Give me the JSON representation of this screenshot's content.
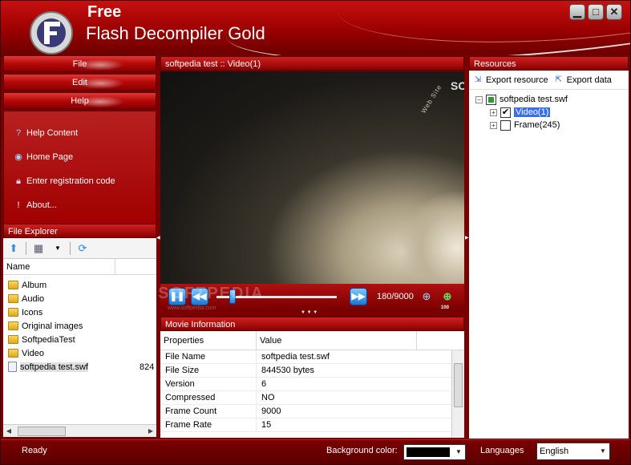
{
  "app": {
    "title_free": "Free",
    "title_main": "Flash Decompiler Gold",
    "window_buttons": {
      "minimize": "▁",
      "maximize": "□",
      "close": "✕"
    }
  },
  "left_menu": {
    "file": "File",
    "edit": "Edit",
    "help": "Help",
    "help_items": [
      {
        "label": "Help Content",
        "icon": "help-icon"
      },
      {
        "label": "Home Page",
        "icon": "globe-icon"
      },
      {
        "label": "Enter registration code",
        "icon": "lock-icon"
      },
      {
        "label": "About...",
        "icon": "info-icon"
      }
    ]
  },
  "file_explorer": {
    "title": "File Explorer",
    "column_name": "Name",
    "items": [
      {
        "name": "Album",
        "type": "folder"
      },
      {
        "name": "Audio",
        "type": "folder"
      },
      {
        "name": "Icons",
        "type": "folder"
      },
      {
        "name": "Original images",
        "type": "folder"
      },
      {
        "name": "SoftpediaTest",
        "type": "folder"
      },
      {
        "name": "Video",
        "type": "folder"
      },
      {
        "name": "softpedia test.swf",
        "type": "file",
        "size": "824"
      }
    ]
  },
  "preview": {
    "title": "softpedia test :: Video(1)",
    "frame_counter": "180/9000",
    "zoom_label": "100",
    "slider_progress": 0.13
  },
  "movie_info": {
    "title": "Movie Information",
    "col_properties": "Properties",
    "col_value": "Value",
    "rows": [
      {
        "key": "File Name",
        "value": "softpedia test.swf"
      },
      {
        "key": "File Size",
        "value": "844530 bytes"
      },
      {
        "key": "Version",
        "value": "6"
      },
      {
        "key": "Compressed",
        "value": "NO"
      },
      {
        "key": "Frame Count",
        "value": "9000"
      },
      {
        "key": "Frame Rate",
        "value": "15"
      }
    ]
  },
  "resources": {
    "title": "Resources",
    "export_resource": "Export resource",
    "export_data": "Export data",
    "root": "softpedia test.swf",
    "children": [
      {
        "label": "Video(1)",
        "checked": true,
        "selected": true
      },
      {
        "label": "Frame(245)",
        "checked": false,
        "selected": false
      }
    ]
  },
  "status": {
    "ready": "Ready",
    "background_color_label": "Background color:",
    "background_color": "#000000",
    "languages_label": "Languages",
    "language": "English"
  },
  "watermark": {
    "main": "SOFTPEDIA",
    "sub": "www.softpedia.com"
  }
}
